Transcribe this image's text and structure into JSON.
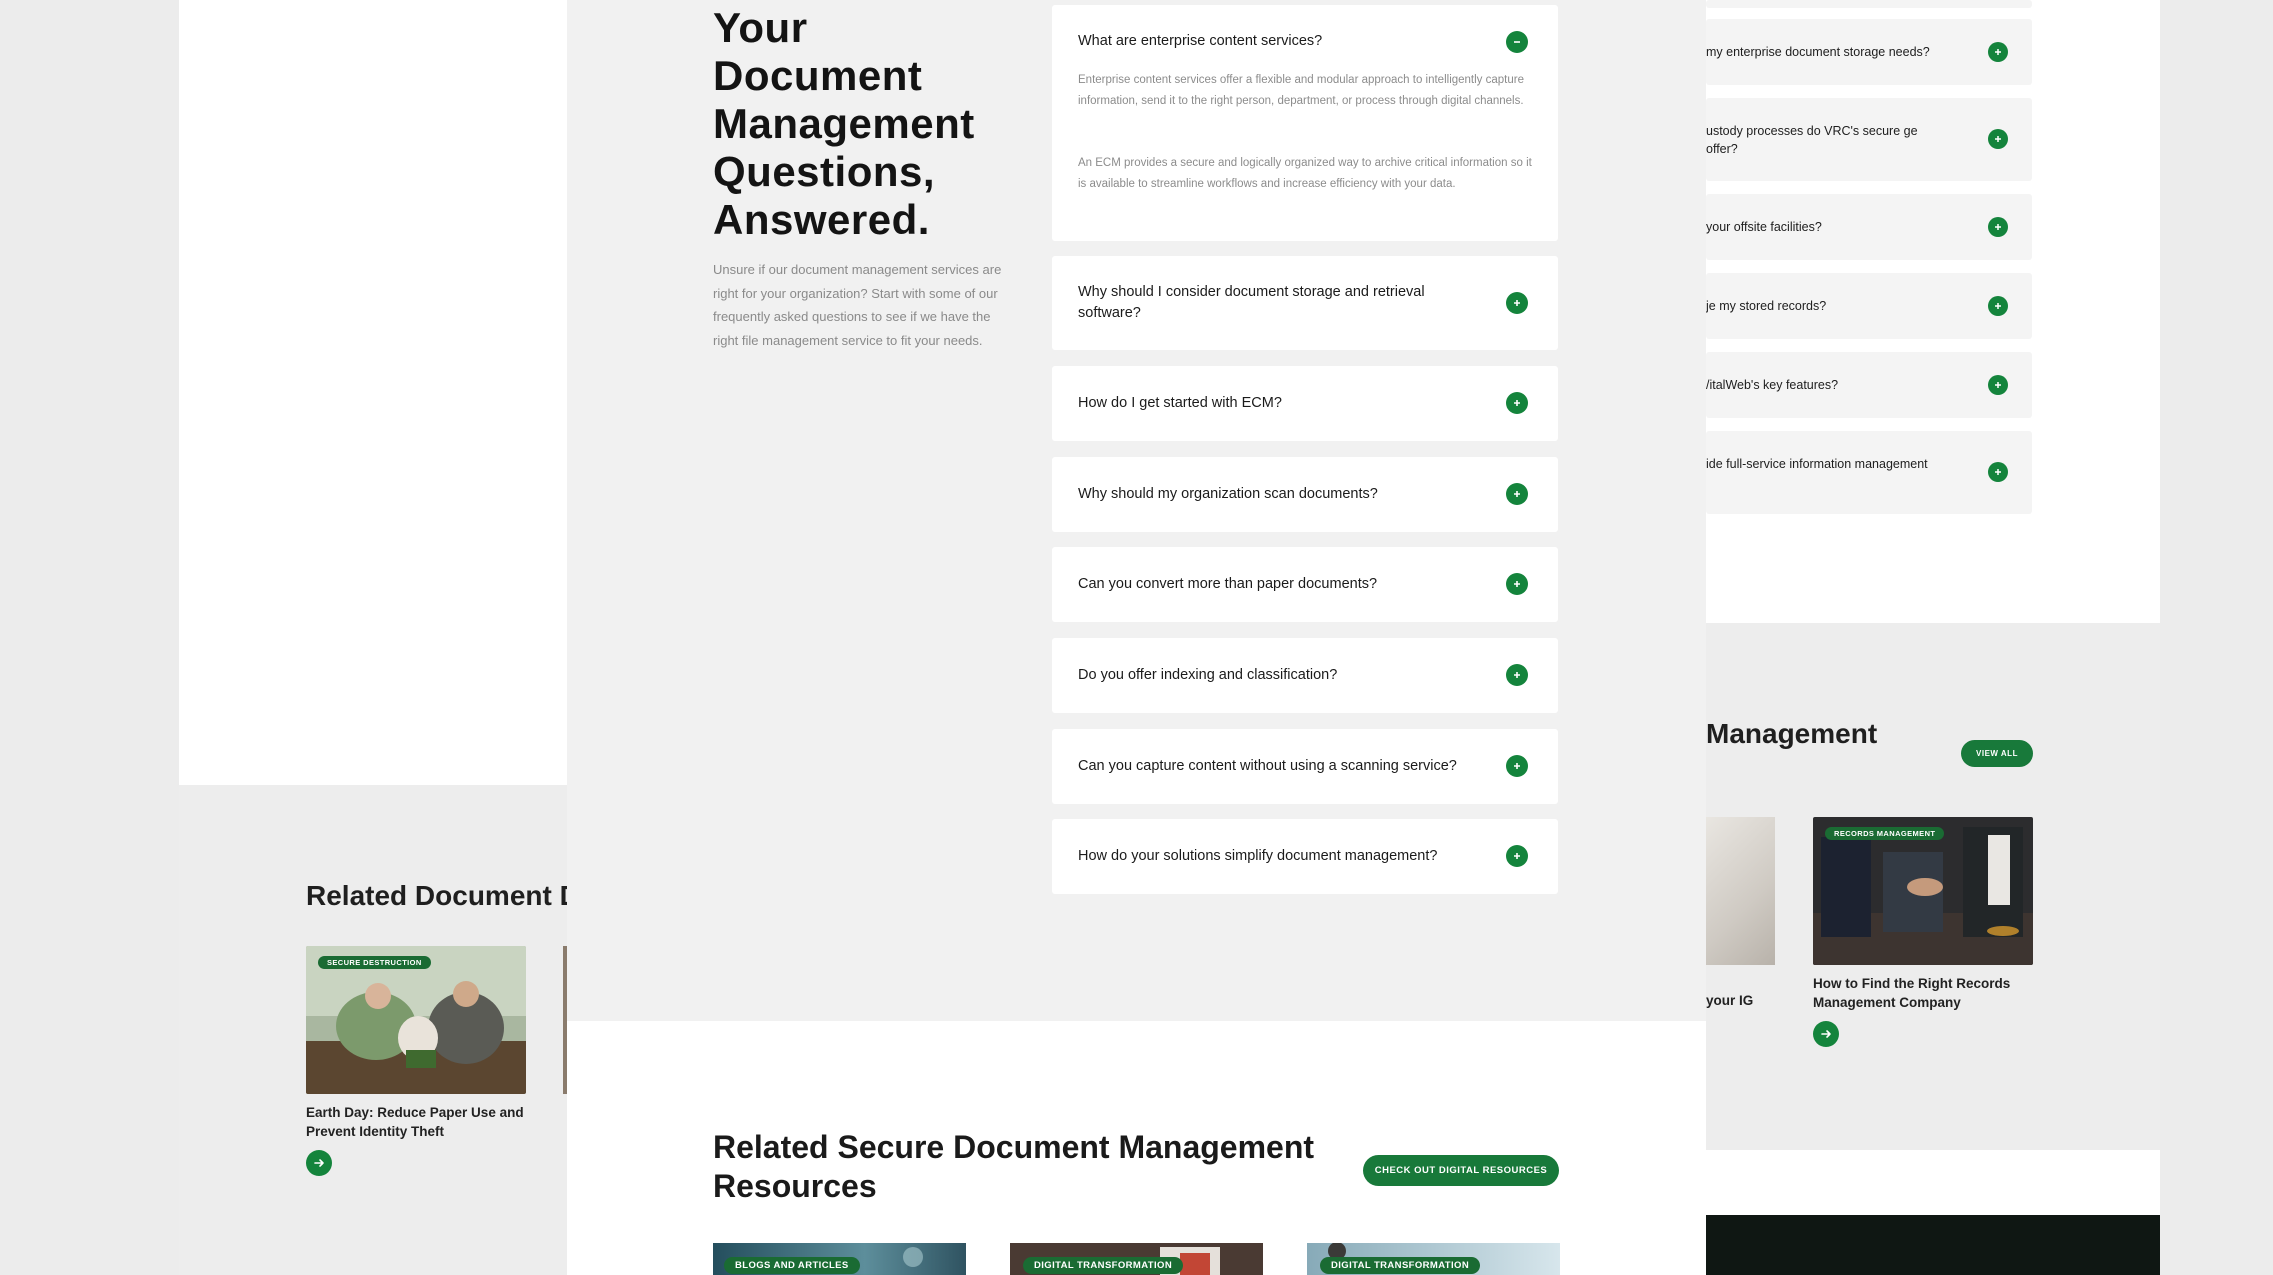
{
  "colors": {
    "brand_green": "#14843c",
    "button_green": "#18793a",
    "badge_green": "#1a6b33",
    "page_grey": "#f1f1f1"
  },
  "main": {
    "heading": "Your Document Management Questions, Answered.",
    "intro": "Unsure if our document management services are right for your organization? Start with some of our frequently asked questions to see if we have the right file management service to fit your needs.",
    "faq": [
      {
        "question": "What are enterprise content services?",
        "expanded": true,
        "icon": "minus-icon",
        "answer": [
          "Enterprise content services offer a flexible and modular approach to intelligently capture information, send it to the right person, department, or process through digital channels.",
          "An ECM provides a secure and logically organized way to archive critical information so it is available to streamline workflows and increase efficiency with your data."
        ]
      },
      {
        "question": "Why should I consider document storage and retrieval software?",
        "expanded": false,
        "icon": "plus-icon"
      },
      {
        "question": "How do I get started with ECM?",
        "expanded": false,
        "icon": "plus-icon"
      },
      {
        "question": "Why should my organization scan documents?",
        "expanded": false,
        "icon": "plus-icon"
      },
      {
        "question": "Can you convert more than paper documents?",
        "expanded": false,
        "icon": "plus-icon"
      },
      {
        "question": "Do you offer indexing and classification?",
        "expanded": false,
        "icon": "plus-icon"
      },
      {
        "question": "Can you capture content without using a scanning service?",
        "expanded": false,
        "icon": "plus-icon"
      },
      {
        "question": "How do your solutions simplify document management?",
        "expanded": false,
        "icon": "plus-icon"
      }
    ],
    "related": {
      "title": "Related Secure Document Management Resources",
      "cta": "CHECK OUT DIGITAL RESOURCES",
      "cards": [
        {
          "badge": "BLOGS AND ARTICLES"
        },
        {
          "badge": "DIGITAL TRANSFORMATION"
        },
        {
          "badge": "DIGITAL TRANSFORMATION"
        }
      ]
    }
  },
  "left_page": {
    "related_title": "Related Document D",
    "card": {
      "badge": "SECURE DESTRUCTION",
      "title": "Earth Day: Reduce Paper Use and Prevent Identity Theft"
    }
  },
  "right_page": {
    "faq": [
      "my enterprise document storage needs?",
      "ustody processes do VRC's secure ge offer?",
      "your offsite facilities?",
      "je my stored records?",
      "/italWeb's key features?",
      "ide full-service information management"
    ],
    "section_title": "Management",
    "view_all": "VIEW ALL",
    "partial_caption": "your IG",
    "card": {
      "badge": "RECORDS MANAGEMENT",
      "title": "How to Find the Right Records Management Company"
    }
  }
}
